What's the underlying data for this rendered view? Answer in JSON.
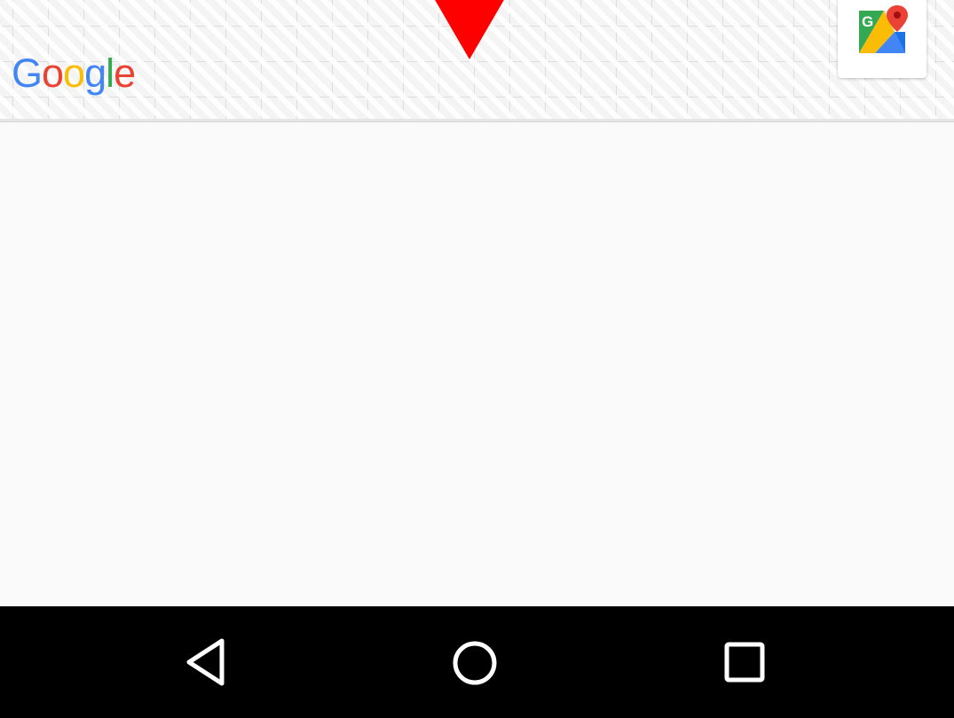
{
  "map": {
    "logo_letters": [
      {
        "char": "G",
        "color": "#4285F4"
      },
      {
        "char": "o",
        "color": "#EA4335"
      },
      {
        "char": "o",
        "color": "#FBBC05"
      },
      {
        "char": "g",
        "color": "#4285F4"
      },
      {
        "char": "l",
        "color": "#34A853"
      },
      {
        "char": "e",
        "color": "#EA4335"
      }
    ],
    "marker_icon": "location-marker-icon",
    "marker_color": "#ff0000",
    "maps_app_icon": "google-maps-icon"
  },
  "navbar": {
    "back_icon": "back-triangle-icon",
    "home_icon": "home-circle-icon",
    "recents_icon": "recents-square-icon",
    "icon_color": "#ffffff",
    "background": "#000000"
  }
}
